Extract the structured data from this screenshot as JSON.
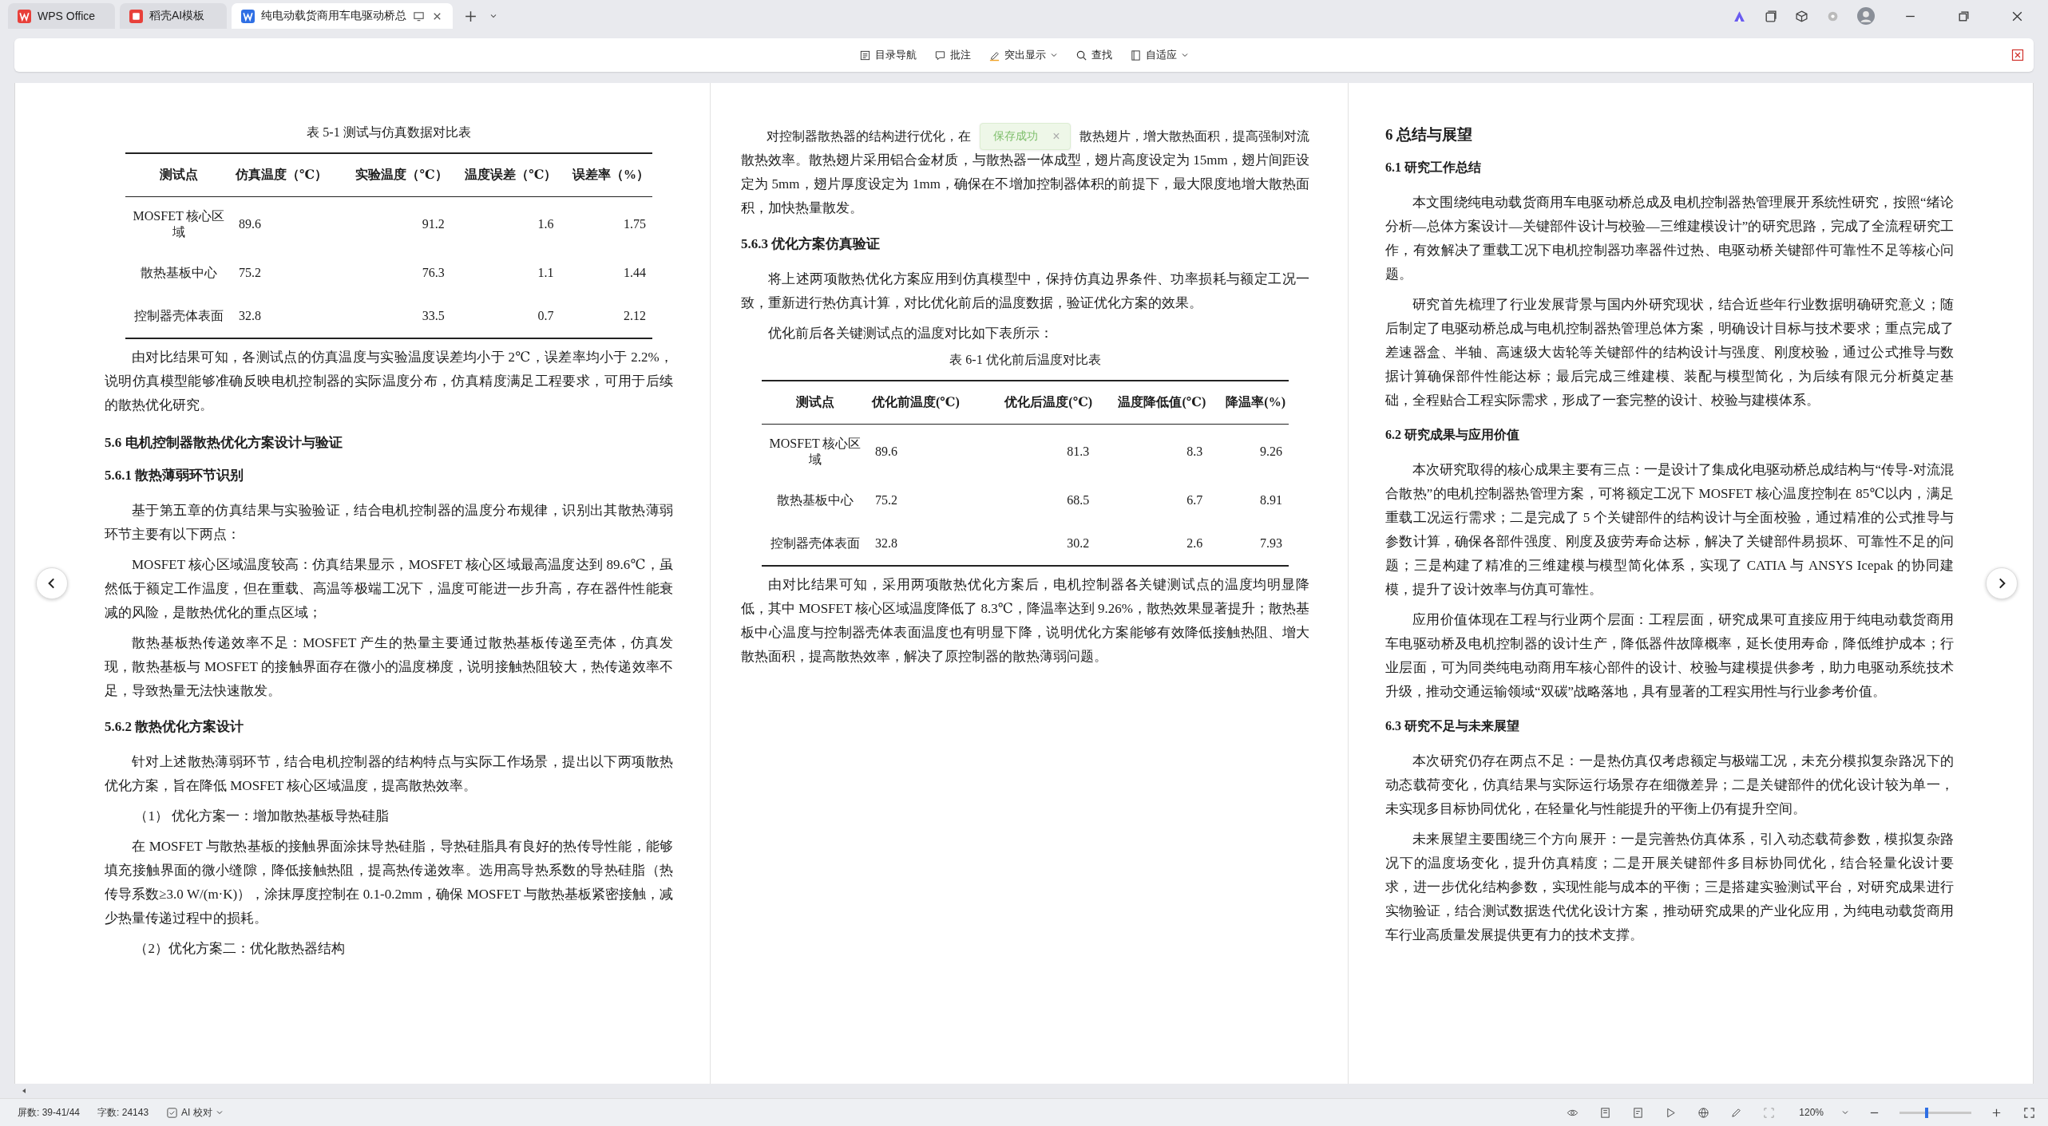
{
  "tabs": [
    {
      "label": "WPS Office",
      "selected": false,
      "kind": "home"
    },
    {
      "label": "稻壳AI模板",
      "selected": false,
      "kind": "template"
    },
    {
      "label": "纯电动载货商用车电驱动桥总",
      "selected": true,
      "kind": "doc"
    }
  ],
  "toolbar": [
    {
      "label": "目录导航",
      "kind": "toc",
      "dropdown": false
    },
    {
      "label": "批注",
      "kind": "comment",
      "dropdown": false
    },
    {
      "label": "突出显示",
      "kind": "highlight",
      "dropdown": true
    },
    {
      "label": "查找",
      "kind": "search",
      "dropdown": false
    },
    {
      "label": "自适应",
      "kind": "fit",
      "dropdown": true
    }
  ],
  "toast": {
    "message": "保存成功",
    "close": "×"
  },
  "columns": [
    {
      "blocks": [
        {
          "kind": "caption",
          "text": "表 5-1  测试与仿真数据对比表"
        },
        {
          "kind": "table",
          "columns": [
            "测试点",
            "仿真温度（℃）",
            "实验温度（℃）",
            "温度误差（℃）",
            "误差率（%）"
          ],
          "rows": [
            [
              "MOSFET 核心区域",
              "89.6",
              "91.2",
              "1.6",
              "1.75"
            ],
            [
              "散热基板中心",
              "75.2",
              "76.3",
              "1.1",
              "1.44"
            ],
            [
              "控制器壳体表面",
              "32.8",
              "33.5",
              "0.7",
              "2.12"
            ]
          ]
        },
        {
          "kind": "para",
          "text": "由对比结果可知，各测试点的仿真温度与实验温度误差均小于 2℃，误差率均小于 2.2%，说明仿真模型能够准确反映电机控制器的实际温度分布，仿真精度满足工程要求，可用于后续的散热优化研究。"
        },
        {
          "kind": "h2",
          "text": "5.6  电机控制器散热优化方案设计与验证"
        },
        {
          "kind": "h3",
          "text": "5.6.1  散热薄弱环节识别"
        },
        {
          "kind": "para",
          "text": "基于第五章的仿真结果与实验验证，结合电机控制器的温度分布规律，识别出其散热薄弱环节主要有以下两点："
        },
        {
          "kind": "para",
          "text": "MOSFET 核心区域温度较高：仿真结果显示，MOSFET 核心区域最高温度达到 89.6℃，虽然低于额定工作温度，但在重载、高温等极端工况下，温度可能进一步升高，存在器件性能衰减的风险，是散热优化的重点区域；"
        },
        {
          "kind": "para",
          "text": "散热基板热传递效率不足：MOSFET 产生的热量主要通过散热基板传递至壳体，仿真发现，散热基板与 MOSFET 的接触界面存在微小的温度梯度，说明接触热阻较大，热传递效率不足，导致热量无法快速散发。"
        },
        {
          "kind": "h3",
          "text": "5.6.2  散热优化方案设计"
        },
        {
          "kind": "para",
          "text": "针对上述散热薄弱环节，结合电机控制器的结构特点与实际工作场景，提出以下两项散热优化方案，旨在降低 MOSFET 核心区域温度，提高散热效率。"
        },
        {
          "kind": "item",
          "text": "（1）  优化方案一：增加散热基板导热硅脂"
        },
        {
          "kind": "para",
          "text": "在 MOSFET 与散热基板的接触界面涂抹导热硅脂，导热硅脂具有良好的热传导性能，能够填充接触界面的微小缝隙，降低接触热阻，提高热传递效率。选用高导热系数的导热硅脂（热传导系数≥3.0 W/(m·K)），涂抹厚度控制在 0.1-0.2mm，确保 MOSFET 与散热基板紧密接触，减少热量传递过程中的损耗。"
        },
        {
          "kind": "item",
          "text": "（2）优化方案二：优化散热器结构"
        }
      ]
    },
    {
      "blocks": [
        {
          "kind": "split",
          "parts": [
            "对控制器散热器的结构进行优化，在",
            "散热翅片，增大散热面积，提高强制对流"
          ],
          "rest": "散热效率。散热翅片采用铝合金材质，与散热器一体成型，翅片高度设定为 15mm，翅片间距设定为 5mm，翅片厚度设定为 1mm，确保在不增加控制器体积的前提下，最大限度地增大散热面积，加快热量散发。"
        },
        {
          "kind": "h3",
          "text": "5.6.3  优化方案仿真验证"
        },
        {
          "kind": "para",
          "text": "将上述两项散热优化方案应用到仿真模型中，保持仿真边界条件、功率损耗与额定工况一致，重新进行热仿真计算，对比优化前后的温度数据，验证优化方案的效果。"
        },
        {
          "kind": "para",
          "text": "优化前后各关键测试点的温度对比如下表所示："
        },
        {
          "kind": "caption",
          "text": "表 6-1  优化前后温度对比表"
        },
        {
          "kind": "table",
          "columns": [
            "测试点",
            "优化前温度(℃)",
            "优化后温度(℃)",
            "温度降低值(℃)",
            "降温率(%)"
          ],
          "rows": [
            [
              "MOSFET 核心区域",
              "89.6",
              "81.3",
              "8.3",
              "9.26"
            ],
            [
              "散热基板中心",
              "75.2",
              "68.5",
              "6.7",
              "8.91"
            ],
            [
              "控制器壳体表面",
              "32.8",
              "30.2",
              "2.6",
              "7.93"
            ]
          ]
        },
        {
          "kind": "para",
          "text": "由对比结果可知，采用两项散热优化方案后，电机控制器各关键测试点的温度均明显降低，其中 MOSFET 核心区域温度降低了 8.3℃，降温率达到 9.26%，散热效果显著提升；散热基板中心温度与控制器壳体表面温度也有明显下降，说明优化方案能够有效降低接触热阻、增大散热面积，提高散热效率，解决了原控制器的散热薄弱问题。"
        }
      ]
    },
    {
      "blocks": [
        {
          "kind": "h1",
          "text": "6  总结与展望"
        },
        {
          "kind": "h2",
          "text": "6.1  研究工作总结"
        },
        {
          "kind": "para",
          "text": "本文围绕纯电动载货商用车电驱动桥总成及电机控制器热管理展开系统性研究，按照“绪论分析—总体方案设计—关键部件设计与校验—三维建模设计”的研究思路，完成了全流程研究工作，有效解决了重载工况下电机控制器功率器件过热、电驱动桥关键部件可靠性不足等核心问题。"
        },
        {
          "kind": "para",
          "text": "研究首先梳理了行业发展背景与国内外研究现状，结合近些年行业数据明确研究意义；随后制定了电驱动桥总成与电机控制器热管理总体方案，明确设计目标与技术要求；重点完成了差速器盒、半轴、高速级大齿轮等关键部件的结构设计与强度、刚度校验，通过公式推导与数据计算确保部件性能达标；最后完成三维建模、装配与模型简化，为后续有限元分析奠定基础，全程贴合工程实际需求，形成了一套完整的设计、校验与建模体系。"
        },
        {
          "kind": "h2",
          "text": "6.2  研究成果与应用价值"
        },
        {
          "kind": "para",
          "text": "本次研究取得的核心成果主要有三点：一是设计了集成化电驱动桥总成结构与“传导-对流混合散热”的电机控制器热管理方案，可将额定工况下 MOSFET 核心温度控制在 85℃以内，满足重载工况运行需求；二是完成了 5 个关键部件的结构设计与全面校验，通过精准的公式推导与参数计算，确保各部件强度、刚度及疲劳寿命达标，解决了关键部件易损坏、可靠性不足的问题；三是构建了精准的三维建模与模型简化体系，实现了 CATIA 与 ANSYS Icepak 的协同建模，提升了设计效率与仿真可靠性。"
        },
        {
          "kind": "para",
          "text": "应用价值体现在工程与行业两个层面：工程层面，研究成果可直接应用于纯电动载货商用车电驱动桥及电机控制器的设计生产，降低器件故障概率，延长使用寿命，降低维护成本；行业层面，可为同类纯电动商用车核心部件的设计、校验与建模提供参考，助力电驱动系统技术升级，推动交通运输领域“双碳”战略落地，具有显著的工程实用性与行业参考价值。"
        },
        {
          "kind": "h2",
          "text": "6.3  研究不足与未来展望"
        },
        {
          "kind": "para",
          "text": "本次研究仍存在两点不足：一是热仿真仅考虑额定与极端工况，未充分模拟复杂路况下的动态载荷变化，仿真结果与实际运行场景存在细微差异；二是关键部件的优化设计较为单一，未实现多目标协同优化，在轻量化与性能提升的平衡上仍有提升空间。"
        },
        {
          "kind": "para",
          "text": "未来展望主要围绕三个方向展开：一是完善热仿真体系，引入动态载荷参数，模拟复杂路况下的温度场变化，提升仿真精度；二是开展关键部件多目标协同优化，结合轻量化设计要求，进一步优化结构参数，实现性能与成本的平衡；三是搭建实验测试平台，对研究成果进行实物验证，结合测试数据迭代优化设计方案，推动研究成果的产业化应用，为纯电动载货商用车行业高质量发展提供更有力的技术支撑。"
        }
      ]
    }
  ],
  "status": {
    "screens": "屏数: 39-41/44",
    "words": "字数: 24143",
    "ai_check": "AI 校对",
    "zoom": "120%",
    "zoom_slider": {
      "level": 0.35
    }
  }
}
